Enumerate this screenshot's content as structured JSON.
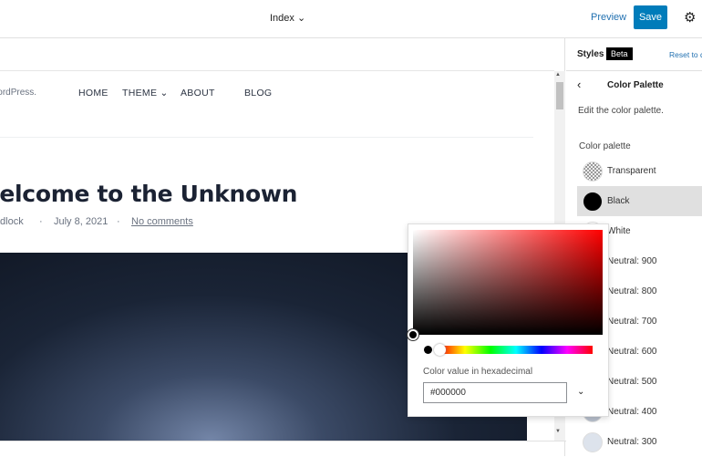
{
  "topbar": {
    "title": "Index",
    "preview": "Preview",
    "save": "Save"
  },
  "site": {
    "name": "WordPress.",
    "nav": [
      "HOME",
      "THEME",
      "ABOUT",
      "BLOG"
    ]
  },
  "post": {
    "title": "Welcome to the Unknown",
    "author": "Hadlock",
    "date": "July 8, 2021",
    "comments": "No comments",
    "sep": "·"
  },
  "sidebar": {
    "styles": "Styles",
    "beta": "Beta",
    "reset": "Reset to defaults",
    "panel_title": "Color Palette",
    "description": "Edit the color palette.",
    "palette_label": "Color palette",
    "colors": [
      {
        "name": "Transparent",
        "hex": "transparent"
      },
      {
        "name": "Black",
        "hex": "#000000"
      },
      {
        "name": "White",
        "hex": "#ffffff"
      },
      {
        "name": "Neutral: 900",
        "hex": "#1b2233"
      },
      {
        "name": "Neutral: 800",
        "hex": "#2b3342"
      },
      {
        "name": "Neutral: 700",
        "hex": "#404a5a"
      },
      {
        "name": "Neutral: 600",
        "hex": "#5a6474"
      },
      {
        "name": "Neutral: 500",
        "hex": "#8a93a3"
      },
      {
        "name": "Neutral: 400",
        "hex": "#b7bfcc"
      },
      {
        "name": "Neutral: 300",
        "hex": "#dde3ec"
      }
    ]
  },
  "picker": {
    "label": "Color value in hexadecimal",
    "value": "#000000"
  }
}
